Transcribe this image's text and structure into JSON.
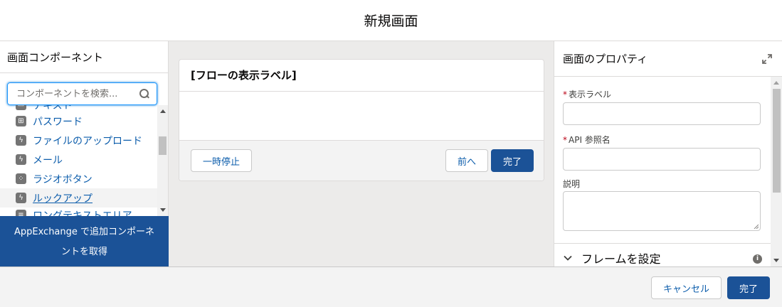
{
  "modal": {
    "title": "新規画面"
  },
  "left_panel": {
    "title": "画面コンポーネント",
    "search": {
      "placeholder": "コンポーネントを検索...",
      "value": ""
    },
    "items": [
      {
        "label": "テキスト",
        "icon": "text-input-icon"
      },
      {
        "label": "パスワード",
        "icon": "password-icon"
      },
      {
        "label": "ファイルのアップロード",
        "icon": "lightning-icon"
      },
      {
        "label": "メール",
        "icon": "lightning-icon"
      },
      {
        "label": "ラジオボタン",
        "icon": "radio-group-icon"
      },
      {
        "label": "ルックアップ",
        "icon": "lightning-icon",
        "selected": true
      },
      {
        "label": "ロングテキストエリア",
        "icon": "text-area-icon"
      }
    ],
    "appexchange_label": "AppExchange で追加コンポーネントを取得"
  },
  "canvas": {
    "screen_title": "[フローの表示ラベル]",
    "pause_label": "一時停止",
    "previous_label": "前へ",
    "finish_label": "完了"
  },
  "right_panel": {
    "title": "画面のプロパティ",
    "fields": {
      "label_label": "表示ラベル",
      "api_name_label": "API 参照名",
      "description_label": "説明",
      "required_marker": "*"
    },
    "section_label": "フレームを設定"
  },
  "footer": {
    "cancel_label": "キャンセル",
    "done_label": "完了"
  },
  "colors": {
    "brand": "#1b5297",
    "link": "#0b5cab",
    "border": "#dddbda"
  }
}
